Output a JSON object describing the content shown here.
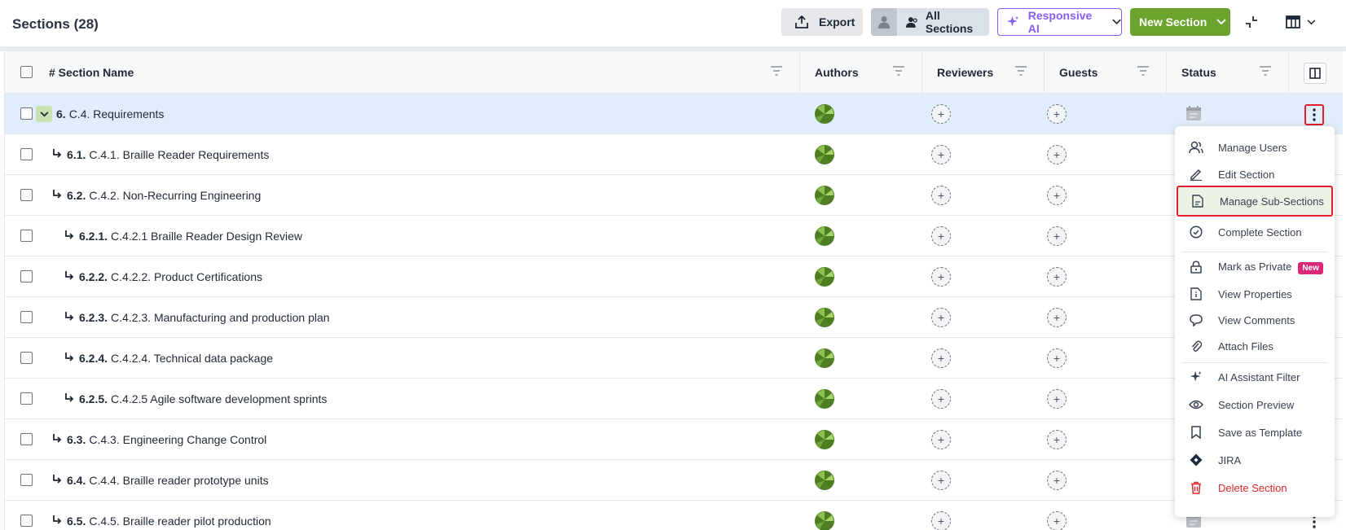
{
  "header": {
    "title": "Sections (28)",
    "export_label": "Export",
    "all_sections_label": "All Sections",
    "ai_label": "Responsive AI",
    "new_section_label": "New Section"
  },
  "columns": {
    "name": "# Section Name",
    "authors": "Authors",
    "reviewers": "Reviewers",
    "guests": "Guests",
    "status": "Status"
  },
  "rows": [
    {
      "num": "6.",
      "title": "C.4. Requirements",
      "level": 0,
      "expandable": true,
      "selected": true
    },
    {
      "num": "6.1.",
      "title": "C.4.1. Braille Reader Requirements",
      "level": 1
    },
    {
      "num": "6.2.",
      "title": "C.4.2. Non-Recurring Engineering",
      "level": 1
    },
    {
      "num": "6.2.1.",
      "title": "C.4.2.1 Braille Reader Design Review",
      "level": 2
    },
    {
      "num": "6.2.2.",
      "title": "C.4.2.2. Product Certifications",
      "level": 2
    },
    {
      "num": "6.2.3.",
      "title": "C.4.2.3. Manufacturing and production plan",
      "level": 2
    },
    {
      "num": "6.2.4.",
      "title": "C.4.2.4. Technical data package",
      "level": 2
    },
    {
      "num": "6.2.5.",
      "title": "C.4.2.5 Agile software development sprints",
      "level": 2
    },
    {
      "num": "6.3.",
      "title": "C.4.3. Engineering Change Control",
      "level": 1
    },
    {
      "num": "6.4.",
      "title": "C.4.4. Braille reader prototype units",
      "level": 1
    },
    {
      "num": "6.5.",
      "title": "C.4.5. Braille reader pilot production",
      "level": 1
    }
  ],
  "menu": {
    "manage_users": "Manage Users",
    "edit_section": "Edit Section",
    "manage_sub_sections": "Manage Sub-Sections",
    "complete_section": "Complete Section",
    "mark_private": "Mark as Private",
    "new_badge": "New",
    "view_properties": "View Properties",
    "view_comments": "View Comments",
    "attach_files": "Attach Files",
    "ai_filter": "AI Assistant Filter",
    "section_preview": "Section Preview",
    "save_template": "Save as Template",
    "jira": "JIRA",
    "delete_section": "Delete Section"
  },
  "colors": {
    "accent_green": "#6aa42e",
    "ai_purple": "#8b5cf6",
    "danger": "#dc2626",
    "selected_row": "#e0eefb"
  }
}
